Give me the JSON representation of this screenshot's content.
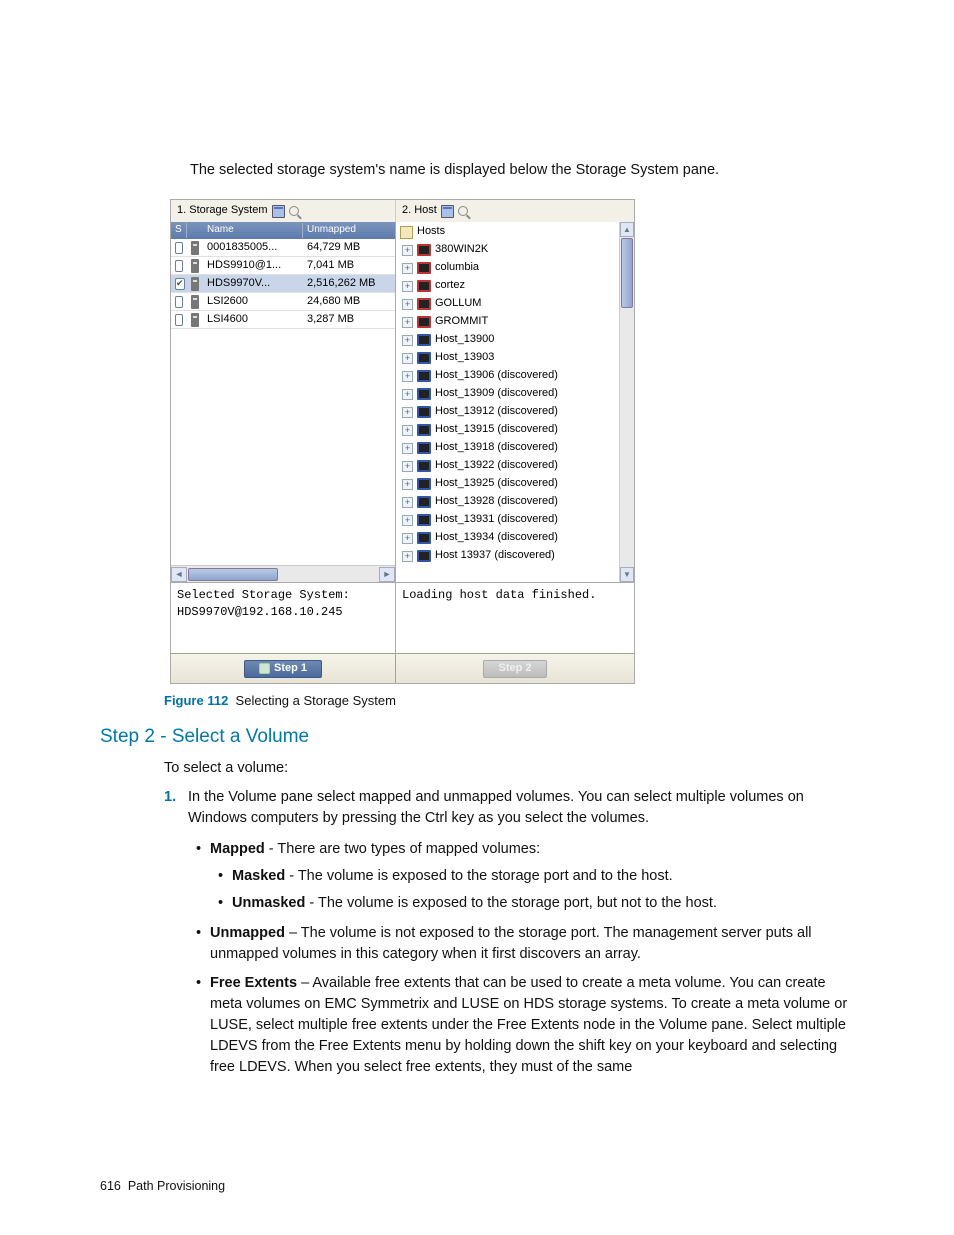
{
  "intro": "The selected storage system's name is displayed below the Storage System pane.",
  "shot": {
    "title_left": "1. Storage System",
    "title_right": "2. Host",
    "hdr": {
      "s": "S",
      "name": "Name",
      "unmapped": "Unmapped"
    },
    "rows": [
      {
        "checked": false,
        "name": "0001835005...",
        "unmapped": "64,729 MB"
      },
      {
        "checked": false,
        "name": "HDS9910@1...",
        "unmapped": "7,041 MB"
      },
      {
        "checked": true,
        "name": "HDS9970V...",
        "unmapped": "2,516,262 MB",
        "selected": true
      },
      {
        "checked": false,
        "name": "LSI2600",
        "unmapped": "24,680 MB"
      },
      {
        "checked": false,
        "name": "LSI4600",
        "unmapped": "3,287 MB"
      }
    ],
    "tree": {
      "root": "Hosts",
      "items": [
        {
          "color": "red",
          "label": "380WIN2K"
        },
        {
          "color": "red",
          "label": "columbia"
        },
        {
          "color": "red",
          "label": "cortez"
        },
        {
          "color": "red",
          "label": "GOLLUM"
        },
        {
          "color": "red",
          "label": "GROMMIT"
        },
        {
          "color": "blue",
          "label": "Host_13900"
        },
        {
          "color": "blue",
          "label": "Host_13903"
        },
        {
          "color": "blue",
          "label": "Host_13906 (discovered)"
        },
        {
          "color": "blue",
          "label": "Host_13909 (discovered)"
        },
        {
          "color": "blue",
          "label": "Host_13912 (discovered)"
        },
        {
          "color": "blue",
          "label": "Host_13915 (discovered)"
        },
        {
          "color": "blue",
          "label": "Host_13918 (discovered)"
        },
        {
          "color": "blue",
          "label": "Host_13922 (discovered)"
        },
        {
          "color": "blue",
          "label": "Host_13925 (discovered)"
        },
        {
          "color": "blue",
          "label": "Host_13928 (discovered)"
        },
        {
          "color": "blue",
          "label": "Host_13931 (discovered)"
        },
        {
          "color": "blue",
          "label": "Host_13934 (discovered)"
        },
        {
          "color": "blue",
          "label": "Host 13937 (discovered)"
        }
      ]
    },
    "status_left_line1": "Selected Storage System:",
    "status_left_line2": "HDS9970V@192.168.10.245",
    "status_right": "Loading host data finished.",
    "btn_left": "Step 1",
    "btn_right": "Step 2"
  },
  "figure": {
    "label": "Figure 112",
    "caption": "Selecting a Storage System"
  },
  "heading": "Step 2 - Select a Volume",
  "para_select": "To select a volume:",
  "step1_num": "1.",
  "step1_text": "In the Volume pane select mapped and unmapped volumes. You can select multiple volumes on Windows computers by pressing the Ctrl key as you select the volumes.",
  "bul": {
    "mapped_head": "Mapped",
    "mapped_rest": " - There are two types of mapped volumes:",
    "masked_head": "Masked",
    "masked_rest": " - The volume is exposed to the storage port and to the host.",
    "unmasked_head": "Unmasked",
    "unmasked_rest": " - The volume is exposed to the storage port, but not to the host.",
    "unmapped_head": "Unmapped",
    "unmapped_rest": " – The volume is not exposed to the storage port. The management server puts all unmapped volumes in this category when it first discovers an array.",
    "free_head": "Free Extents",
    "free_rest": " – Available free extents that can be used to create a meta volume. You can create meta volumes on EMC Symmetrix and LUSE on HDS storage systems. To create a meta volume or LUSE, select multiple free extents under the Free Extents node in the Volume pane. Select multiple LDEVS from the Free Extents menu by holding down the shift key on your keyboard and selecting free LDEVS. When you select free extents, they must of the same"
  },
  "footer": {
    "page": "616",
    "section": "Path Provisioning"
  }
}
